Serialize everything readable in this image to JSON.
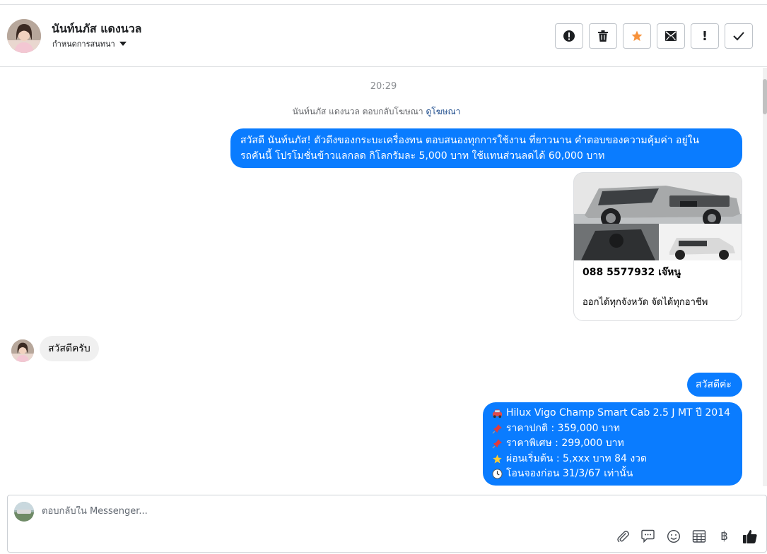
{
  "header": {
    "contact_name": "นันท์นภัส แดงนวล",
    "assign_label": "กำหนดการสนทนา",
    "actions": [
      {
        "name": "report-icon",
        "label": "!"
      },
      {
        "name": "trash-icon"
      },
      {
        "name": "star-icon"
      },
      {
        "name": "mark-unread-icon"
      },
      {
        "name": "follow-up-icon",
        "label": "!"
      },
      {
        "name": "done-check-icon"
      }
    ]
  },
  "thread": {
    "timestamp": "20:29",
    "ad_reply_text": "นันท์นภัส แดงนวล ตอบกลับโฆษณา",
    "ad_reply_link": "ดูโฆษณา",
    "messages": {
      "greeting_ad_line1": "สวัสดี นันท์นภัส! ตัวดีงของกระบะเครื่องทน ตอบสนองทุกการใช้งาน ที่ยาวนาน คำตอบของความคุ้มค่า อยู่ใน",
      "greeting_ad_line2": "รถคันนี้ โปรโมชั่นข้าวแลกลด กิโลกรัมละ 5,000 บาท ใช้แทนส่วนลดได้ 60,000 บาท",
      "card_phone": "088 5577932 เจ๊หนู",
      "card_subtitle": "ออกได้ทุกจังหวัด จัดได้ทุกอาชีพ",
      "incoming_hello": "สวัสดีครับ",
      "reply_hello": "สวัสดีค่ะ",
      "details": [
        {
          "icon": "car-icon",
          "text": "Hilux Vigo Champ Smart Cab 2.5 J MT ปี 2014"
        },
        {
          "icon": "pushpin-icon",
          "text": "ราคาปกติ : 359,000 บาท"
        },
        {
          "icon": "pushpin-icon",
          "text": "ราคาพิเศษ : 299,000 บาท"
        },
        {
          "icon": "star-emoji-icon",
          "text": "ผ่อนเริ่มต้น : 5,xxx บาท 84 งวด"
        },
        {
          "icon": "clock-icon",
          "text": "โอนจองก่อน 31/3/67 เท่านั้น"
        }
      ]
    }
  },
  "composer": {
    "placeholder": "ตอบกลับใน Messenger...",
    "tools": [
      "paperclip-icon",
      "saved-reply-icon",
      "emoji-icon",
      "table-icon",
      "baht-icon",
      "thumbs-up-icon"
    ]
  },
  "colors": {
    "outgoing_bubble": "#0a7cff",
    "incoming_bubble": "#f0f0f0",
    "star_accent": "#f7923b"
  }
}
